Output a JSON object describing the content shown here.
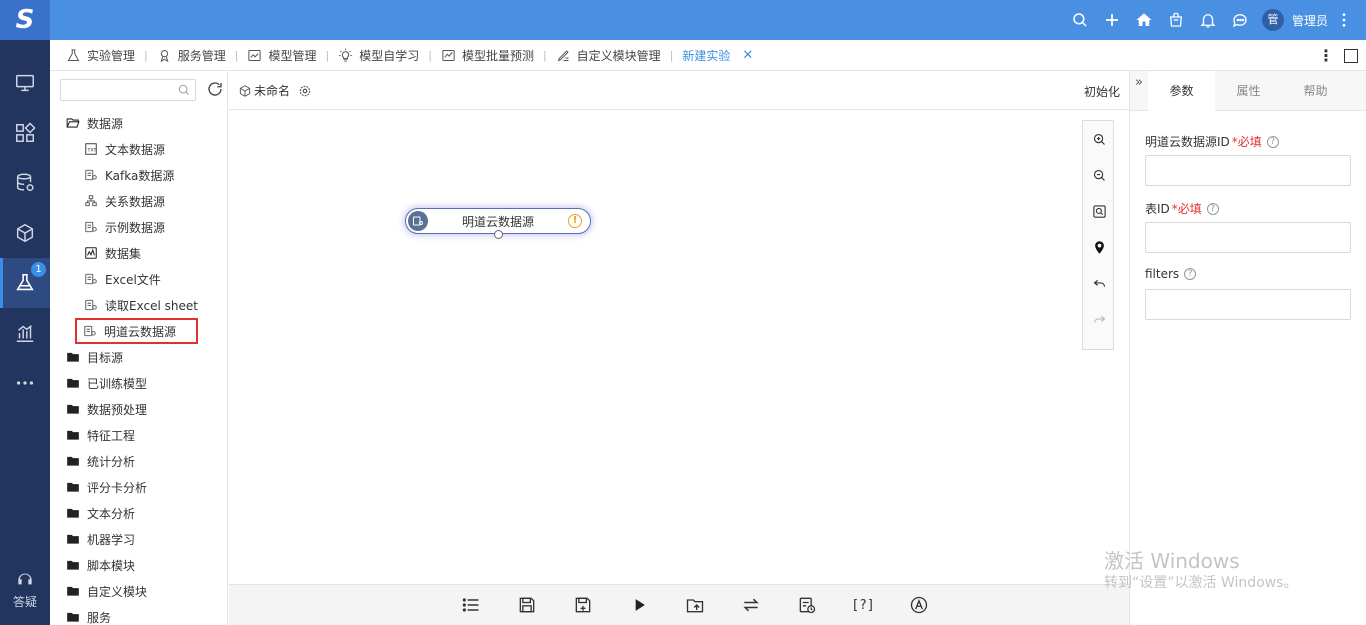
{
  "app": {
    "logo": "S",
    "nav_badge": "1",
    "help_label": "答疑"
  },
  "header": {
    "user_avatar": "管",
    "user_name": "管理员"
  },
  "tabs": [
    {
      "label": "实验管理",
      "icon": "flask-icon"
    },
    {
      "label": "服务管理",
      "icon": "service-icon"
    },
    {
      "label": "模型管理",
      "icon": "model-icon"
    },
    {
      "label": "模型自学习",
      "icon": "bulb-icon"
    },
    {
      "label": "模型批量预测",
      "icon": "chart-line-icon"
    },
    {
      "label": "自定义模块管理",
      "icon": "edit-icon"
    },
    {
      "label": "新建实验",
      "icon": ""
    }
  ],
  "tree": {
    "search_placeholder": "",
    "items": [
      {
        "label": "数据源",
        "type": "folder-open"
      },
      {
        "label": "文本数据源",
        "type": "leaf",
        "icon": "txt-file-icon"
      },
      {
        "label": "Kafka数据源",
        "type": "leaf",
        "icon": "datasource-icon"
      },
      {
        "label": "关系数据源",
        "type": "leaf",
        "icon": "relation-icon"
      },
      {
        "label": "示例数据源",
        "type": "leaf",
        "icon": "datasource-icon"
      },
      {
        "label": "数据集",
        "type": "leaf",
        "icon": "dataset-icon"
      },
      {
        "label": "Excel文件",
        "type": "leaf",
        "icon": "datasource-icon"
      },
      {
        "label": "读取Excel sheet",
        "type": "leaf",
        "icon": "datasource-icon"
      },
      {
        "label": "明道云数据源",
        "type": "leaf",
        "icon": "datasource-icon",
        "highlight": true
      },
      {
        "label": "目标源",
        "type": "folder"
      },
      {
        "label": "已训练模型",
        "type": "folder"
      },
      {
        "label": "数据预处理",
        "type": "folder"
      },
      {
        "label": "特征工程",
        "type": "folder"
      },
      {
        "label": "统计分析",
        "type": "folder"
      },
      {
        "label": "评分卡分析",
        "type": "folder"
      },
      {
        "label": "文本分析",
        "type": "folder"
      },
      {
        "label": "机器学习",
        "type": "folder"
      },
      {
        "label": "脚本模块",
        "type": "folder"
      },
      {
        "label": "自定义模块",
        "type": "folder"
      },
      {
        "label": "服务",
        "type": "folder"
      }
    ]
  },
  "canvas": {
    "experiment_name": "未命名",
    "init_label": "初始化",
    "node_label": "明道云数据源",
    "node_warning": "!",
    "bottom_toolbar_text": "[?]"
  },
  "right_panel": {
    "tabs": [
      "参数",
      "属性",
      "帮助"
    ],
    "collapse": "»",
    "fields": [
      {
        "label": "明道云数据源ID",
        "required": "*必填",
        "value": ""
      },
      {
        "label": "表ID",
        "required": "*必填",
        "value": ""
      },
      {
        "label": "filters",
        "required": "",
        "value": ""
      }
    ]
  },
  "watermark": {
    "line1": "激活 Windows",
    "line2": "转到“设置”以激活 Windows。"
  },
  "colors": {
    "topbar": "#4a90e2",
    "leftnav": "#22355e",
    "accent": "#3a8ee6",
    "highlight": "#e03030"
  }
}
